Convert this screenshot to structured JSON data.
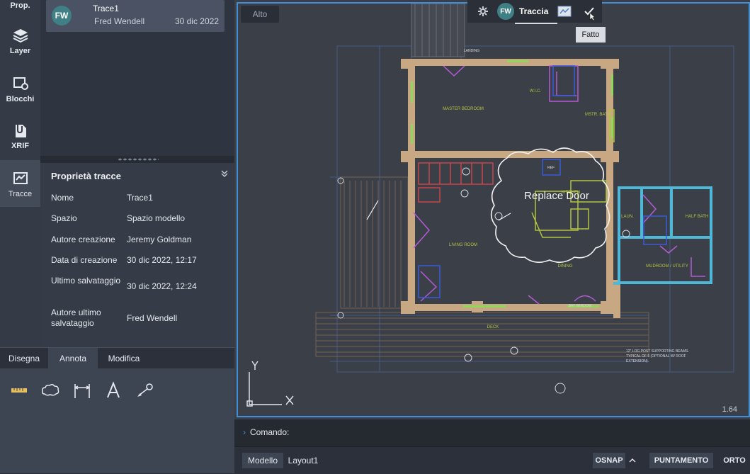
{
  "rail": {
    "props": "Prop.",
    "layer": "Layer",
    "blocks": "Blocchi",
    "xrif": "XRIF",
    "traces": "Tracce"
  },
  "trace_item": {
    "initials": "FW",
    "name": "Trace1",
    "author": "Fred Wendell",
    "date": "30 dic 2022"
  },
  "properties": {
    "title": "Proprietà tracce",
    "rows": [
      {
        "k": "Nome",
        "v": "Trace1"
      },
      {
        "k": "Spazio",
        "v": "Spazio modello"
      },
      {
        "k": "Autore creazione",
        "v": "Jeremy Goldman"
      },
      {
        "k": "Data di creazione",
        "v": "30 dic 2022, 12:17"
      },
      {
        "k": "Ultimo salvataggio",
        "v": "30 dic 2022, 12:24"
      },
      {
        "k": "Autore ultimo salvataggio",
        "v": "Fred Wendell"
      }
    ]
  },
  "tabs": [
    "Disegna",
    "Annota",
    "Modifica"
  ],
  "view_label": "Alto",
  "trace_toolbar": {
    "initials": "FW",
    "label": "Traccia"
  },
  "tooltip": "Fatto",
  "markup": "Replace Door",
  "drawing_labels": {
    "master": "MASTER BEDROOM",
    "wic": "W.I.C.",
    "mstr_bath": "MSTR. BATH",
    "kitchen": "KITCHEN",
    "living": "LIVING ROOM",
    "dining": "DINING",
    "deck": "DECK",
    "laun": "LAUN.",
    "half_bath": "HALF BATH",
    "mudroom": "MUDROOM / UTILITY",
    "landing": "LANDING",
    "ref": "REF",
    "bay": "BAY WINDOW",
    "note": "12\" LOG POST SUPPORTING BEAMS. TYPICAL OF 5 (OPTIONAL W/ ROOF EXTENSION).",
    "scale": "1.64"
  },
  "command_label": "Comando:",
  "status": {
    "model": "Modello",
    "layout": "Layout1",
    "osnap": "OSNAP",
    "tracking": "PUNTAMENTO",
    "ortho": "ORTO"
  }
}
